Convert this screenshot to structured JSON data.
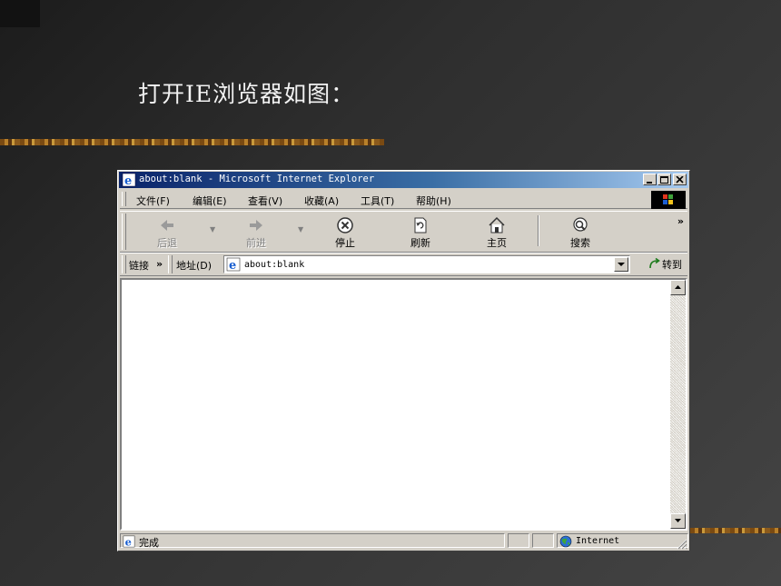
{
  "slide": {
    "title": "打开IE浏览器如图："
  },
  "window": {
    "title": "about:blank - Microsoft Internet Explorer",
    "controls": [
      "minimize-icon",
      "maximize-icon",
      "close-icon"
    ]
  },
  "menubar": {
    "items": [
      {
        "label": "文件(F)"
      },
      {
        "label": "编辑(E)"
      },
      {
        "label": "查看(V)"
      },
      {
        "label": "收藏(A)"
      },
      {
        "label": "工具(T)"
      },
      {
        "label": "帮助(H)"
      }
    ]
  },
  "toolbar": {
    "back": "后退",
    "forward": "前进",
    "stop": "停止",
    "refresh": "刷新",
    "home": "主页",
    "search": "搜索",
    "more": "»"
  },
  "addressbar": {
    "links": "链接",
    "links_more": "»",
    "label": "地址(D)",
    "value": "about:blank",
    "go": "转到"
  },
  "statusbar": {
    "status": "完成",
    "zone": "Internet"
  },
  "colors": {
    "titlebar_start": "#0a246a",
    "titlebar_end": "#a6caf0",
    "chrome": "#d4d0c8"
  }
}
